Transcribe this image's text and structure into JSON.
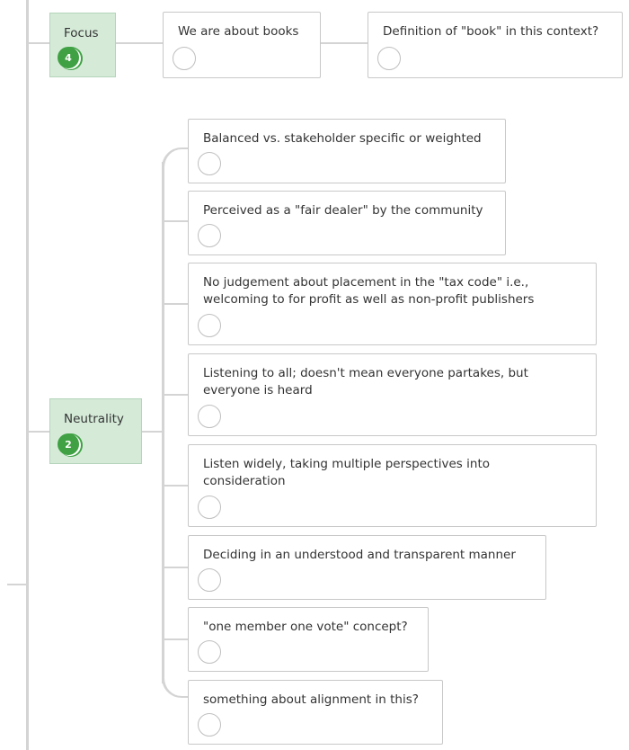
{
  "categories": [
    {
      "label": "Focus",
      "count": "4",
      "items": [
        "We are about books",
        "Definition of \"book\" in this context?"
      ]
    },
    {
      "label": "Neutrality",
      "count": "2",
      "items": [
        "Balanced vs. stakeholder specific or weighted",
        "Perceived as a \"fair dealer\" by the community",
        "No judgement about placement in the \"tax code\" i.e., welcoming to for profit as well as non-profit publishers",
        "Listening to all; doesn't mean everyone partakes, but everyone is heard",
        "Listen widely, taking multiple perspectives into consideration",
        "Deciding in an understood and transparent manner",
        "\"one member one vote\" concept?",
        "something about alignment in this?"
      ]
    }
  ],
  "colors": {
    "category_bg": "#d5ebd8",
    "badge": "#3fa143",
    "connector": "#d4d4d4",
    "card_border": "#c8c8c8"
  }
}
